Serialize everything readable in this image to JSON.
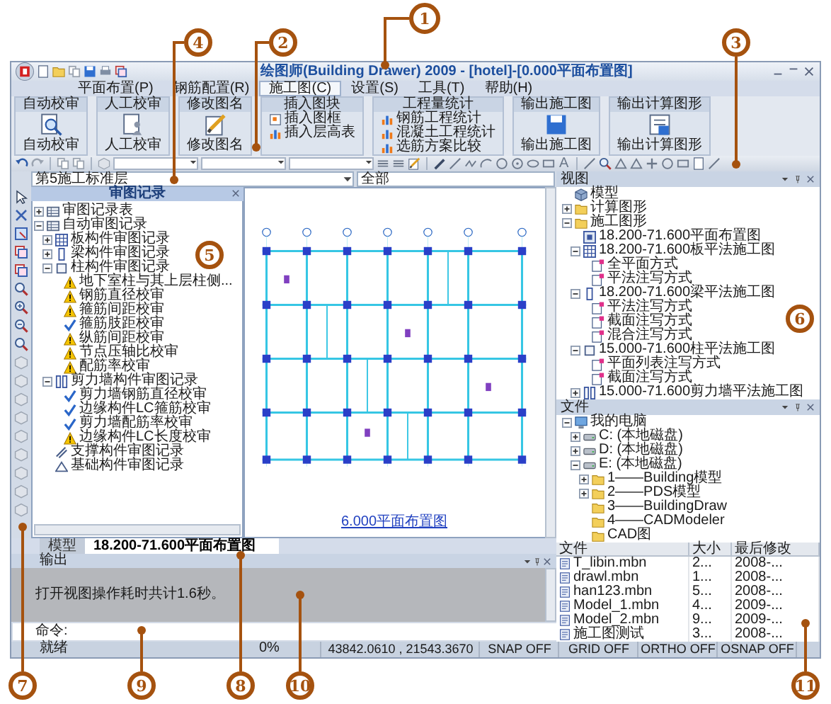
{
  "window": {
    "title": "绘图师(Building Drawer) 2009 - [hotel]-[0.000平面布置图]"
  },
  "menu": [
    {
      "label": "平面布置(P)",
      "selected": false
    },
    {
      "label": "钢筋配置(R)",
      "selected": false
    },
    {
      "label": "施工图(C)",
      "selected": true
    },
    {
      "label": "设置(S)",
      "selected": false
    },
    {
      "label": "工具(T)",
      "selected": false
    },
    {
      "label": "帮助(H)",
      "selected": false
    }
  ],
  "ribbon": [
    {
      "title": "自动校审",
      "buttons": [
        {
          "label": "自动校审",
          "kind": "large"
        }
      ]
    },
    {
      "title": "人工校审",
      "buttons": [
        {
          "label": "人工校审",
          "kind": "large"
        }
      ]
    },
    {
      "title": "修改图名",
      "buttons": [
        {
          "label": "修改图名",
          "kind": "large"
        }
      ]
    },
    {
      "title": "插入图块",
      "buttons": [
        {
          "label": "插入图框",
          "kind": "small"
        },
        {
          "label": "插入层高表",
          "kind": "small"
        }
      ]
    },
    {
      "title": "工程量统计",
      "buttons": [
        {
          "label": "钢筋工程统计",
          "kind": "small"
        },
        {
          "label": "混凝土工程统计",
          "kind": "small"
        },
        {
          "label": "选筋方案比较",
          "kind": "small"
        }
      ]
    },
    {
      "title": "输出施工图",
      "buttons": [
        {
          "label": "输出施工图",
          "kind": "large"
        }
      ]
    },
    {
      "title": "输出计算图形",
      "buttons": [
        {
          "label": "输出计算图形",
          "kind": "large"
        }
      ]
    }
  ],
  "toolbar": {
    "text_tool": "A"
  },
  "layer_select": {
    "value": "第5施工标准层"
  },
  "scope_select": {
    "value": "全部"
  },
  "review_panel": {
    "title": "审图记录",
    "tree": [
      {
        "label": "审图记录表",
        "kind": "table",
        "expanded": false
      },
      {
        "label": "自动审图记录",
        "kind": "table",
        "expanded": true,
        "children": [
          {
            "label": "板构件审图记录",
            "kind": "slab",
            "expanded": false
          },
          {
            "label": "梁构件审图记录",
            "kind": "beam",
            "expanded": false
          },
          {
            "label": "柱构件审图记录",
            "kind": "column",
            "expanded": true,
            "children": [
              {
                "label": "地下室柱与其上层柱侧...",
                "kind": "warning"
              },
              {
                "label": "钢筋直径校审",
                "kind": "warning"
              },
              {
                "label": "箍筋间距校审",
                "kind": "warning"
              },
              {
                "label": "箍筋肢距校审",
                "kind": "pass"
              },
              {
                "label": "纵筋间距校审",
                "kind": "warning"
              },
              {
                "label": "节点压轴比校审",
                "kind": "warning"
              },
              {
                "label": "配筋率校审",
                "kind": "warning"
              }
            ]
          },
          {
            "label": "剪力墙构件审图记录",
            "kind": "wall",
            "expanded": true,
            "children": [
              {
                "label": "剪力墙钢筋直径校审",
                "kind": "pass"
              },
              {
                "label": "边缘构件LC箍筋校审",
                "kind": "pass"
              },
              {
                "label": "剪力墙配筋率校审",
                "kind": "pass"
              },
              {
                "label": "边缘构件LC长度校审",
                "kind": "warning"
              }
            ]
          },
          {
            "label": "支撑构件审图记录",
            "kind": "brace"
          },
          {
            "label": "基础构件审图记录",
            "kind": "foundation"
          }
        ]
      }
    ]
  },
  "canvas": {
    "drawing_title": "6.000平面布置图"
  },
  "doc_tabs": [
    {
      "label": "模型",
      "selected": false
    },
    {
      "label": "18.200-71.600平面布置图",
      "selected": true
    }
  ],
  "output": {
    "title": "输出",
    "message": "打开视图操作耗时共计1.6秒。",
    "command": "命令:"
  },
  "view_panel": {
    "title": "视图",
    "tree": [
      {
        "label": "模型",
        "kind": "model"
      },
      {
        "label": "计算图形",
        "kind": "folder",
        "expanded": false
      },
      {
        "label": "施工图形",
        "kind": "folder",
        "expanded": true,
        "children": [
          {
            "label": "18.200-71.600平面布置图",
            "kind": "plan"
          },
          {
            "label": "18.200-71.600板平法施工图",
            "kind": "slab",
            "expanded": true,
            "children": [
              {
                "label": "全平面方式",
                "kind": "mode"
              },
              {
                "label": "平法注写方式",
                "kind": "mode"
              }
            ]
          },
          {
            "label": "18.200-71.600梁平法施工图",
            "kind": "beam",
            "expanded": true,
            "children": [
              {
                "label": "平法注写方式",
                "kind": "mode"
              },
              {
                "label": "截面注写方式",
                "kind": "mode"
              },
              {
                "label": "混合注写方式",
                "kind": "mode"
              }
            ]
          },
          {
            "label": "15.000-71.600柱平法施工图",
            "kind": "column",
            "expanded": true,
            "children": [
              {
                "label": "平面列表注写方式",
                "kind": "mode"
              },
              {
                "label": "截面注写方式",
                "kind": "mode"
              }
            ]
          },
          {
            "label": "15.000-71.600剪力墙平法施工图",
            "kind": "wall",
            "expanded": false
          }
        ]
      }
    ]
  },
  "file_panel": {
    "title": "文件",
    "tree": [
      {
        "label": "我的电脑",
        "kind": "computer",
        "expanded": true,
        "children": [
          {
            "label": "C: (本地磁盘)",
            "kind": "drive",
            "expanded": false
          },
          {
            "label": "D: (本地磁盘)",
            "kind": "drive",
            "expanded": false
          },
          {
            "label": "E: (本地磁盘)",
            "kind": "drive",
            "expanded": true,
            "children": [
              {
                "label": "1——Building模型",
                "kind": "folder",
                "expanded": false
              },
              {
                "label": "2——PDS模型",
                "kind": "folder",
                "expanded": false
              },
              {
                "label": "3——BuildingDraw",
                "kind": "folder"
              },
              {
                "label": "4——CADModeler",
                "kind": "folder"
              },
              {
                "label": "CAD图",
                "kind": "folder"
              }
            ]
          }
        ]
      }
    ]
  },
  "file_list": {
    "columns": [
      "文件",
      "大小",
      "最后修改"
    ],
    "rows": [
      [
        "T_libin.mbn",
        "2...",
        "2008-..."
      ],
      [
        "drawl.mbn",
        "1...",
        "2008-..."
      ],
      [
        "han123.mbn",
        "5...",
        "2008-..."
      ],
      [
        "Model_1.mbn",
        "4...",
        "2009-..."
      ],
      [
        "Model_2.mbn",
        "9...",
        "2009-..."
      ],
      [
        "施工图测试",
        "3...",
        "2008-..."
      ]
    ]
  },
  "status_bar": {
    "items": [
      "就绪",
      "0%",
      "43842.0610 , 21543.3670",
      "SNAP OFF",
      "GRID OFF",
      "ORTHO OFF",
      "OSNAP OFF"
    ]
  },
  "callouts": [
    {
      "label": "1"
    },
    {
      "label": "4"
    },
    {
      "label": "2"
    },
    {
      "label": "3"
    },
    {
      "label": "5"
    },
    {
      "label": "6"
    },
    {
      "label": "7"
    },
    {
      "label": "9"
    },
    {
      "label": "8"
    },
    {
      "label": "10"
    },
    {
      "label": "11"
    }
  ]
}
